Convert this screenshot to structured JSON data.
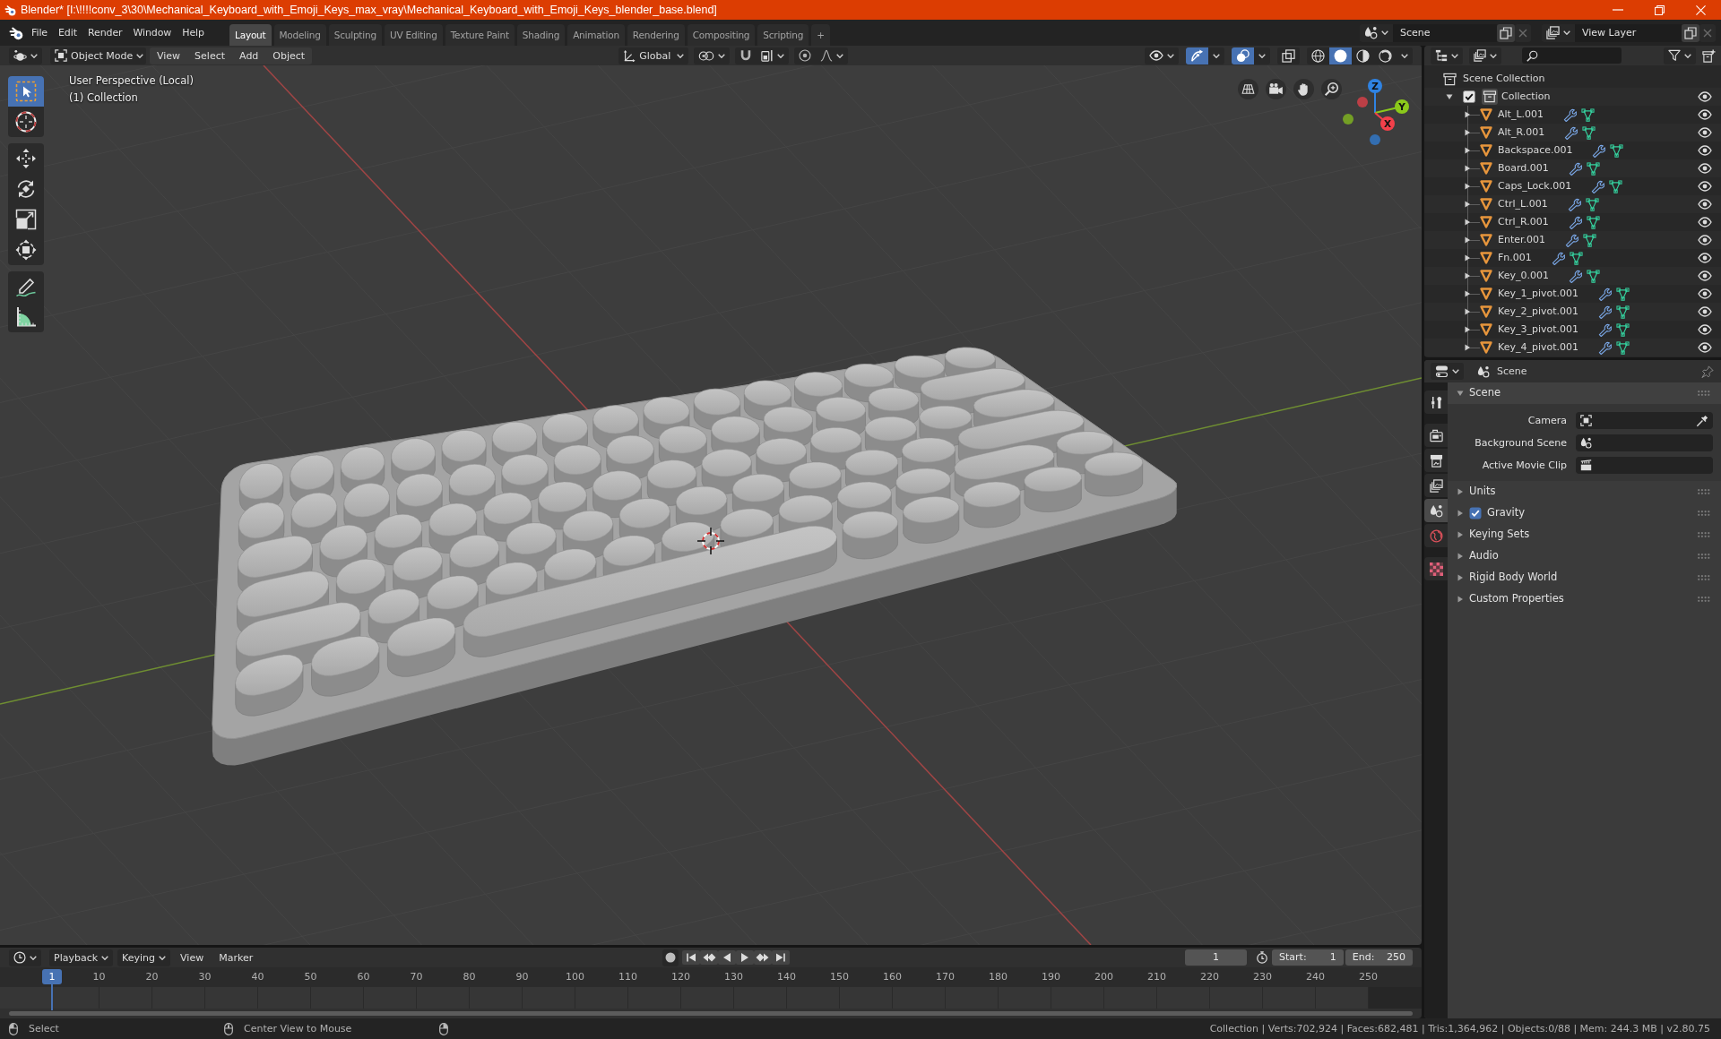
{
  "window": {
    "title": "Blender* [I:\\!!!!conv_3\\30\\Mechanical_Keyboard_with_Emoji_Keys_max_vray\\Mechanical_Keyboard_with_Emoji_Keys_blender_base.blend]"
  },
  "menu": [
    "File",
    "Edit",
    "Render",
    "Window",
    "Help"
  ],
  "workspaces": [
    {
      "label": "Layout",
      "selected": true
    },
    {
      "label": "Modeling",
      "selected": false
    },
    {
      "label": "Sculpting",
      "selected": false
    },
    {
      "label": "UV Editing",
      "selected": false
    },
    {
      "label": "Texture Paint",
      "selected": false
    },
    {
      "label": "Shading",
      "selected": false
    },
    {
      "label": "Animation",
      "selected": false
    },
    {
      "label": "Rendering",
      "selected": false
    },
    {
      "label": "Compositing",
      "selected": false
    },
    {
      "label": "Scripting",
      "selected": false
    }
  ],
  "add_workspace": "+",
  "scene": {
    "value": "Scene"
  },
  "view_layer": {
    "value": "View Layer"
  },
  "viewport": {
    "mode": "Object Mode",
    "menus": [
      "View",
      "Select",
      "Add",
      "Object"
    ],
    "orientation": "Global",
    "snap": false,
    "proportional_editing": false,
    "toggles": [
      {
        "kind": "gizmos",
        "on": true
      },
      {
        "kind": "overlays",
        "on": true
      },
      {
        "kind": "xray",
        "on": false
      }
    ],
    "shading": [
      {
        "kind": "wireframe",
        "selected": false
      },
      {
        "kind": "solid",
        "selected": true
      },
      {
        "kind": "material",
        "selected": false
      },
      {
        "kind": "rendered",
        "selected": false
      }
    ],
    "view_name": "User Perspective (Local)",
    "collection_label": "(1) Collection",
    "tool_groups": [
      [
        {
          "kind": "select_box",
          "selected": true
        },
        {
          "kind": "cursor",
          "selected": false
        }
      ],
      [
        {
          "kind": "move",
          "selected": false
        },
        {
          "kind": "rotate",
          "selected": false
        },
        {
          "kind": "scale",
          "selected": false
        },
        {
          "kind": "transform",
          "selected": false
        }
      ],
      [
        {
          "kind": "annotate",
          "selected": false
        },
        {
          "kind": "measure",
          "selected": false
        }
      ]
    ],
    "gizmo": [
      {
        "label": "Z",
        "color": "#2f83e3"
      },
      {
        "label": "Y",
        "color": "#8bc91b"
      },
      {
        "label": "X",
        "color": "#f2404a"
      }
    ]
  },
  "outliner": {
    "root": "Scene Collection",
    "items": [
      {
        "name": "Collection",
        "expanded": true,
        "checked": true,
        "visible": true,
        "children": [
          {
            "name": "Alt_L.001",
            "expanded": false,
            "visible": true
          },
          {
            "name": "Alt_R.001",
            "expanded": false,
            "visible": true
          },
          {
            "name": "Backspace.001",
            "expanded": false,
            "visible": true
          },
          {
            "name": "Board.001",
            "expanded": false,
            "visible": true
          },
          {
            "name": "Caps_Lock.001",
            "expanded": false,
            "visible": true
          },
          {
            "name": "Ctrl_L.001",
            "expanded": false,
            "visible": true
          },
          {
            "name": "Ctrl_R.001",
            "expanded": false,
            "visible": true
          },
          {
            "name": "Enter.001",
            "expanded": false,
            "visible": true
          },
          {
            "name": "Fn.001",
            "expanded": false,
            "visible": true
          },
          {
            "name": "Key_0.001",
            "expanded": false,
            "visible": true
          },
          {
            "name": "Key_1_pivot.001",
            "expanded": false,
            "visible": true
          },
          {
            "name": "Key_2_pivot.001",
            "expanded": false,
            "visible": true
          },
          {
            "name": "Key_3_pivot.001",
            "expanded": false,
            "visible": true
          },
          {
            "name": "Key_4_pivot.001",
            "expanded": false,
            "visible": true
          }
        ]
      }
    ]
  },
  "properties": {
    "context": "Scene",
    "tab_groups": [
      [
        {
          "kind": "tool",
          "selected": false
        }
      ],
      [
        {
          "kind": "render",
          "selected": false
        },
        {
          "kind": "output",
          "selected": false
        },
        {
          "kind": "view_layer",
          "selected": false
        },
        {
          "kind": "scene",
          "selected": true
        },
        {
          "kind": "world",
          "selected": false
        }
      ],
      [
        {
          "kind": "texture",
          "selected": false
        }
      ]
    ],
    "panels": [
      {
        "title": "Scene",
        "expanded": true,
        "fields": [
          {
            "label": "Camera",
            "kind": "camera"
          },
          {
            "label": "Background Scene",
            "kind": "scene"
          },
          {
            "label": "Active Movie Clip",
            "kind": "movie_clip"
          }
        ]
      },
      {
        "title": "Units",
        "expanded": false
      },
      {
        "title": "Gravity",
        "expanded": false,
        "checked": true
      },
      {
        "title": "Keying Sets",
        "expanded": false
      },
      {
        "title": "Audio",
        "expanded": false
      },
      {
        "title": "Rigid Body World",
        "expanded": false
      },
      {
        "title": "Custom Properties",
        "expanded": false
      }
    ]
  },
  "timeline": {
    "menus": [
      "Playback",
      "Keying",
      "View",
      "Marker"
    ],
    "auto_keying": false,
    "current_frame": "1",
    "start": {
      "label": "Start:",
      "value": "1"
    },
    "end": {
      "label": "End:",
      "value": "250"
    },
    "playhead": "1",
    "ruler": [
      "10",
      "20",
      "30",
      "40",
      "50",
      "60",
      "70",
      "80",
      "90",
      "100",
      "110",
      "120",
      "130",
      "140",
      "150",
      "160",
      "170",
      "180",
      "190",
      "200",
      "210",
      "220",
      "230",
      "240",
      "250"
    ]
  },
  "status_bar": {
    "hints": [
      {
        "kind": "left",
        "text": "Select"
      },
      {
        "kind": "middle",
        "text": "Center View to Mouse"
      },
      {
        "kind": "right"
      }
    ],
    "stats": "Collection | Verts:702,924 | Faces:682,481 | Tris:1,364,962 | Objects:0/88 | Mem: 244.3 MB | v2.80.75"
  }
}
